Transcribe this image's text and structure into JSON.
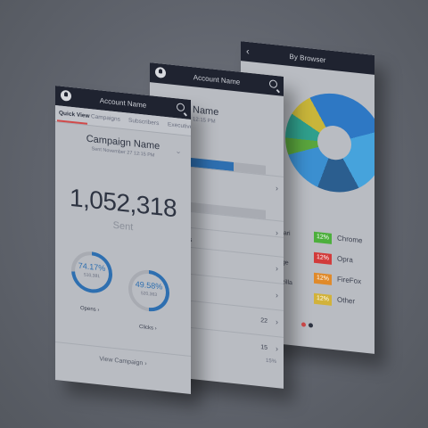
{
  "screen1": {
    "header_title": "Account Name",
    "tabs": [
      "Quick View",
      "Campaigns",
      "Subscribers",
      "Executive"
    ],
    "campaign_title": "Campaign Name",
    "campaign_subtitle": "Sent November 27 12:15 PM",
    "sent_count": "1,052,318",
    "sent_label": "Sent",
    "opens": {
      "percent": "74.17%",
      "count": "510,381",
      "label": "Opens ›",
      "fraction": 0.74
    },
    "clicks": {
      "percent": "49.58%",
      "count": "520,363",
      "label": "Clicks ›",
      "fraction": 0.5
    },
    "view_campaign": "View Campaign ›"
  },
  "screen2": {
    "header_title": "Account Name",
    "heading_fragment": "Name",
    "sub_fragment": "12:15 PM",
    "bar1_fraction": 0.72,
    "bar2_fraction": 0.24,
    "row_labels": [
      "ds",
      "rs"
    ],
    "rows_with_numbers": [
      {
        "num": "22"
      },
      {
        "num": "15"
      }
    ],
    "footer": "15%"
  },
  "screen3": {
    "header_title": "By Browser",
    "back_label": "‹",
    "left_labels": [
      "afari",
      "dge",
      "ozilla"
    ],
    "legend": [
      {
        "pct": "12%",
        "label": "Chrome",
        "color": "#4caf3c"
      },
      {
        "pct": "12%",
        "label": "Opra",
        "color": "#d23b3b"
      },
      {
        "pct": "12%",
        "label": "FireFox",
        "color": "#e08a2a"
      },
      {
        "pct": "12%",
        "label": "Other",
        "color": "#d2b23a"
      }
    ]
  },
  "colors": {
    "accent": "#2e6fb0",
    "navbar": "#1f2330",
    "tab_underline": "#d04a4a"
  }
}
